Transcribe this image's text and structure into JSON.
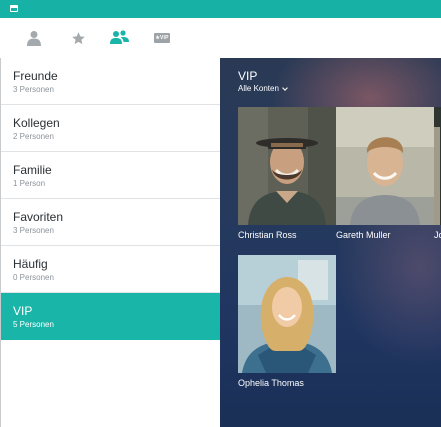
{
  "toolbar": {
    "tabs": [
      {
        "icon": "person-icon",
        "label": "Kontakte"
      },
      {
        "icon": "star-icon",
        "label": "Favoriten"
      },
      {
        "icon": "group-icon",
        "label": "Gruppen",
        "active": true
      },
      {
        "icon": "vip-icon",
        "label": "VIP",
        "badge_text": "★VIP"
      }
    ]
  },
  "sidebar": {
    "groups": [
      {
        "name": "Freunde",
        "count": "3 Personen"
      },
      {
        "name": "Kollegen",
        "count": "2 Personen"
      },
      {
        "name": "Familie",
        "count": "1 Person"
      },
      {
        "name": "Favoriten",
        "count": "3 Personen"
      },
      {
        "name": "Häufig",
        "count": "0 Personen"
      },
      {
        "name": "VIP",
        "count": "5 Personen",
        "selected": true
      }
    ]
  },
  "main": {
    "title": "VIP",
    "account_filter": "Alle Konten",
    "contacts": [
      {
        "name": "Christian Ross"
      },
      {
        "name": "Gareth Muller"
      },
      {
        "name": "Jo"
      },
      {
        "name": "Ophelia Thomas"
      }
    ]
  },
  "colors": {
    "accent": "#19b5a9",
    "icon_gray": "#9da3a6",
    "panel_bg": "#223659"
  }
}
